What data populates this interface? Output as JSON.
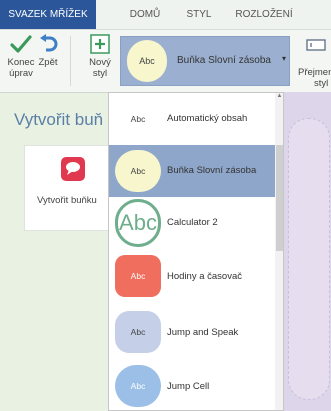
{
  "tabs": [
    "SVAZEK MŘÍŽEK",
    "DOMŮ",
    "STYL",
    "ROZLOŽENÍ"
  ],
  "ribbon": {
    "done_line1": "Konec",
    "done_line2": "úprav",
    "undo": "Zpět",
    "new_line1": "Nový",
    "new_line2": "styl",
    "gallery_selected_label": "Buňka Slovní zásoba",
    "gallery_swatch_text": "Abc",
    "right_line1": "Přejmen",
    "right_line2": "styl"
  },
  "left_pane": {
    "title": "Vytvořit buň",
    "card_label": "Vytvořit buňku"
  },
  "dropdown": {
    "items": [
      {
        "swatch": "Abc",
        "label": "Automatický obsah",
        "color": "#ffffff"
      },
      {
        "swatch": "Abc",
        "label": "Buňka Slovní zásoba",
        "color": "#f7f6cd",
        "selected": true
      },
      {
        "swatch": "Abc",
        "label": "Calculator 2",
        "color": "#ffffff",
        "ring": "#6fae8c"
      },
      {
        "swatch": "Abc",
        "label": "Hodiny a časovač",
        "color": "#ef6e5d"
      },
      {
        "swatch": "Abc",
        "label": "Jump and Speak",
        "color": "#c5d0e8"
      },
      {
        "swatch": "Abc",
        "label": "Jump Cell",
        "color": "#9bbfe6"
      }
    ]
  },
  "colors": {
    "accent": "#2b579a",
    "check_green": "#3a9a5b",
    "undo_blue": "#3f7fc6",
    "selection": "#8ea6c9"
  }
}
